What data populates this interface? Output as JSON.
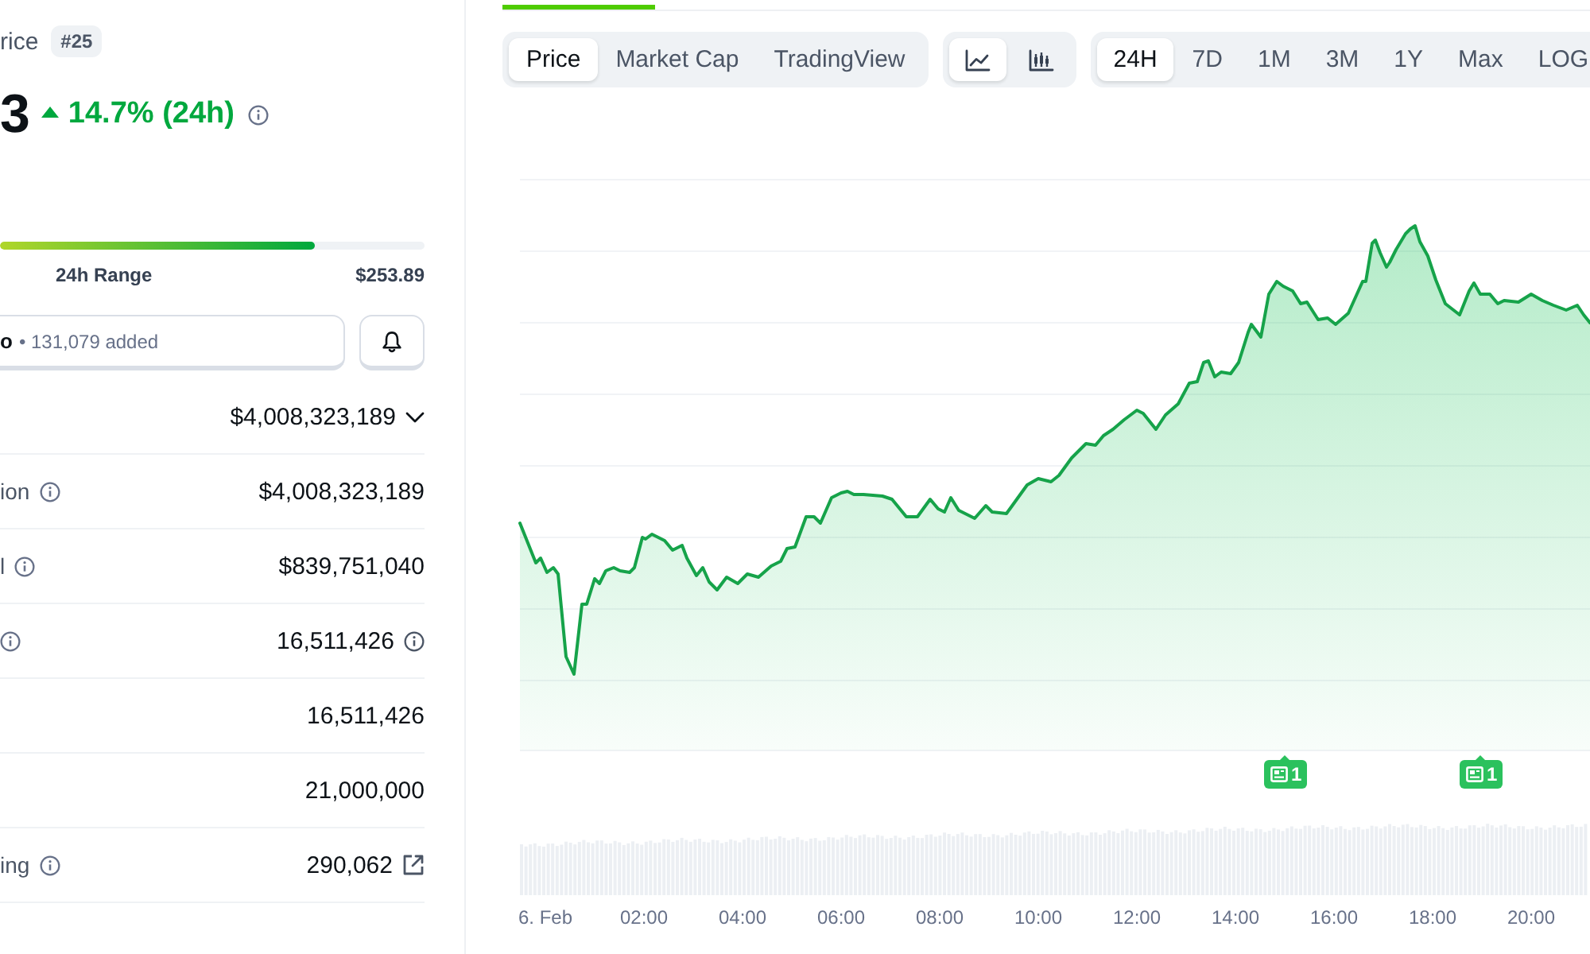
{
  "header": {
    "title": "rice",
    "rank": "#25"
  },
  "price": {
    "value": "3",
    "rising": true,
    "change": "14.7% (24h)"
  },
  "range_24h": {
    "level": 0.74,
    "label": "24h Range",
    "high": "$253.89"
  },
  "portfolio": {
    "label": "o",
    "added": "• 131,079 added"
  },
  "stats": [
    {
      "value": "$4,008,323,189",
      "kind": "dropdown",
      "info": false
    },
    {
      "label": "ion",
      "value": "$4,008,323,189",
      "kind": "plain",
      "info": true
    },
    {
      "label": "l",
      "value": "$839,751,040",
      "kind": "plain",
      "info": true
    },
    {
      "value": "16,511,426",
      "kind": "hint",
      "info": true
    },
    {
      "value": "16,511,426",
      "kind": "plain",
      "info": false
    },
    {
      "value": "21,000,000",
      "kind": "plain",
      "info": false
    },
    {
      "label": "ing",
      "value": "290,062",
      "kind": "link",
      "info": true
    }
  ],
  "chart_tabs": [
    {
      "label": "Price",
      "selected": true
    },
    {
      "label": "Market Cap",
      "selected": false
    },
    {
      "label": "TradingView",
      "selected": false
    }
  ],
  "chart_types": [
    {
      "kind": "line",
      "selected": true
    },
    {
      "kind": "candles",
      "selected": false
    }
  ],
  "periods": [
    {
      "label": "24H",
      "selected": true
    },
    {
      "label": "7D",
      "selected": false
    },
    {
      "label": "1M",
      "selected": false
    },
    {
      "label": "3M",
      "selected": false
    },
    {
      "label": "1Y",
      "selected": false
    },
    {
      "label": "Max",
      "selected": false
    },
    {
      "label": "LOG",
      "selected": false
    }
  ],
  "chart": {
    "x_labels": [
      "6. Feb",
      "02:00",
      "04:00",
      "06:00",
      "08:00",
      "10:00",
      "12:00",
      "14:00",
      "16:00",
      "18:00",
      "20:00"
    ],
    "news_markers": [
      {
        "count": "1"
      },
      {
        "count": "1"
      }
    ]
  }
}
